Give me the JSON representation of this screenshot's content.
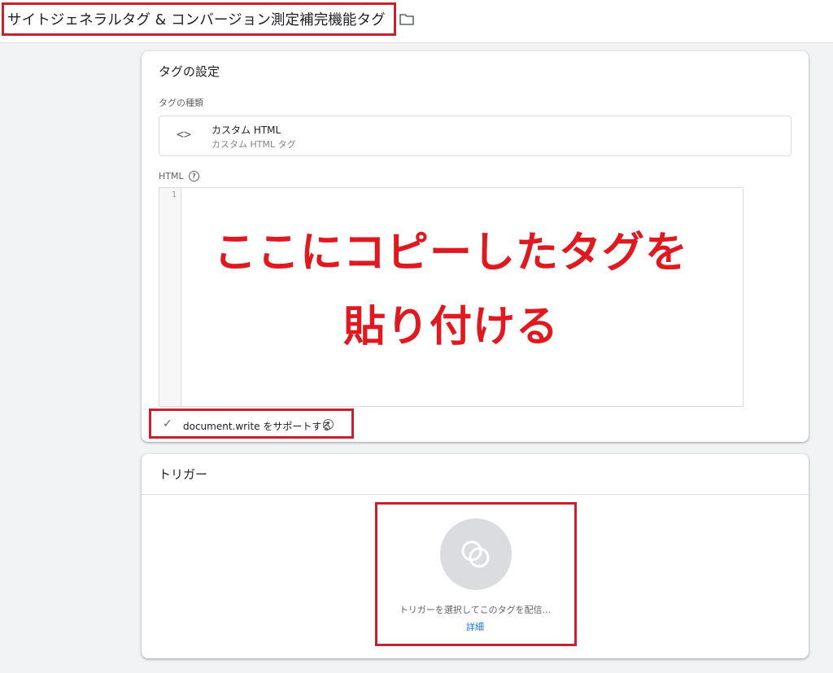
{
  "header": {
    "tag_name": "サイトジェネラルタグ & コンバージョン測定補完機能タグ",
    "folder_icon": "folder-outline-icon"
  },
  "tag_config": {
    "title": "タグの設定",
    "type_label": "タグの種類",
    "type": {
      "icon": "code-brackets-icon",
      "name": "カスタム HTML",
      "description": "カスタム HTML タグ"
    },
    "html_label": "HTML",
    "editor": {
      "line_numbers": [
        "1"
      ],
      "overlay_line1": "ここにコピーしたタグを",
      "overlay_line2": "貼り付ける"
    },
    "document_write": {
      "checked": true,
      "label": "document.write をサポートする"
    }
  },
  "trigger": {
    "title": "トリガー",
    "icon": "trigger-overlap-circles-icon",
    "prompt": "トリガーを選択してこのタグを配信...",
    "details_link": "詳細"
  },
  "colors": {
    "annotation_red": "#c8202c",
    "overlay_text_red": "#e0181f",
    "link_blue": "#1a73e8",
    "page_background": "#f1f3f4"
  }
}
